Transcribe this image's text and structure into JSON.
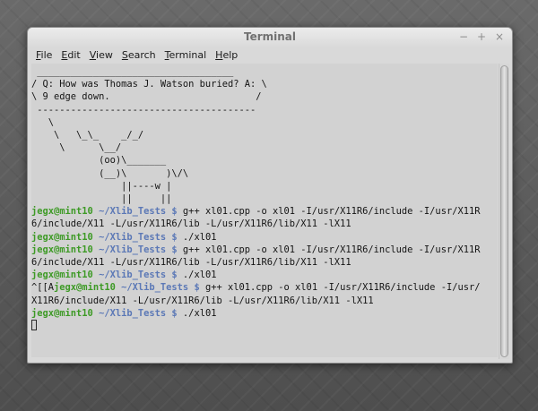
{
  "window": {
    "title": "Terminal",
    "controls": {
      "minimize": "−",
      "maximize": "+",
      "close": "×"
    }
  },
  "menu": [
    {
      "mnemonic": "F",
      "rest": "ile"
    },
    {
      "mnemonic": "E",
      "rest": "dit"
    },
    {
      "mnemonic": "V",
      "rest": "iew"
    },
    {
      "mnemonic": "S",
      "rest": "earch"
    },
    {
      "mnemonic": "T",
      "rest": "erminal"
    },
    {
      "mnemonic": "H",
      "rest": "elp"
    }
  ],
  "terminal": {
    "lines": [
      {
        "text": " ___________________________________"
      },
      {
        "text": "/ Q: How was Thomas J. Watson buried? A: \\"
      },
      {
        "text": "\\ 9 edge down.                          /"
      },
      {
        "text": " ---------------------------------------"
      },
      {
        "text": "   \\"
      },
      {
        "text": "    \\   \\_\\_    _/_/"
      },
      {
        "text": "     \\      \\__/"
      },
      {
        "text": "            (oo)\\_______"
      },
      {
        "text": "            (__)\\       )\\/\\"
      },
      {
        "text": "                ||----w |"
      },
      {
        "text": "                ||     ||"
      },
      {
        "prefix": "",
        "user": "jegx@mint10",
        "path": " ~/Xlib_Tests $",
        "cmd": " g++ xl01.cpp -o xl01 -I/usr/X11R6/include -I/usr/X11R"
      },
      {
        "text": "6/include/X11 -L/usr/X11R6/lib -L/usr/X11R6/lib/X11 -lX11"
      },
      {
        "prefix": "",
        "user": "jegx@mint10",
        "path": " ~/Xlib_Tests $",
        "cmd": " ./xl01"
      },
      {
        "prefix": "",
        "user": "jegx@mint10",
        "path": " ~/Xlib_Tests $",
        "cmd": " g++ xl01.cpp -o xl01 -I/usr/X11R6/include -I/usr/X11R"
      },
      {
        "text": "6/include/X11 -L/usr/X11R6/lib -L/usr/X11R6/lib/X11 -lX11"
      },
      {
        "prefix": "",
        "user": "jegx@mint10",
        "path": " ~/Xlib_Tests $",
        "cmd": " ./xl01"
      },
      {
        "prefix": "^[[A",
        "user": "jegx@mint10",
        "path": " ~/Xlib_Tests $",
        "cmd": " g++ xl01.cpp -o xl01 -I/usr/X11R6/include -I/usr/"
      },
      {
        "text": "X11R6/include/X11 -L/usr/X11R6/lib -L/usr/X11R6/lib/X11 -lX11"
      },
      {
        "prefix": "",
        "user": "jegx@mint10",
        "path": " ~/Xlib_Tests $",
        "cmd": " ./xl01"
      }
    ]
  }
}
